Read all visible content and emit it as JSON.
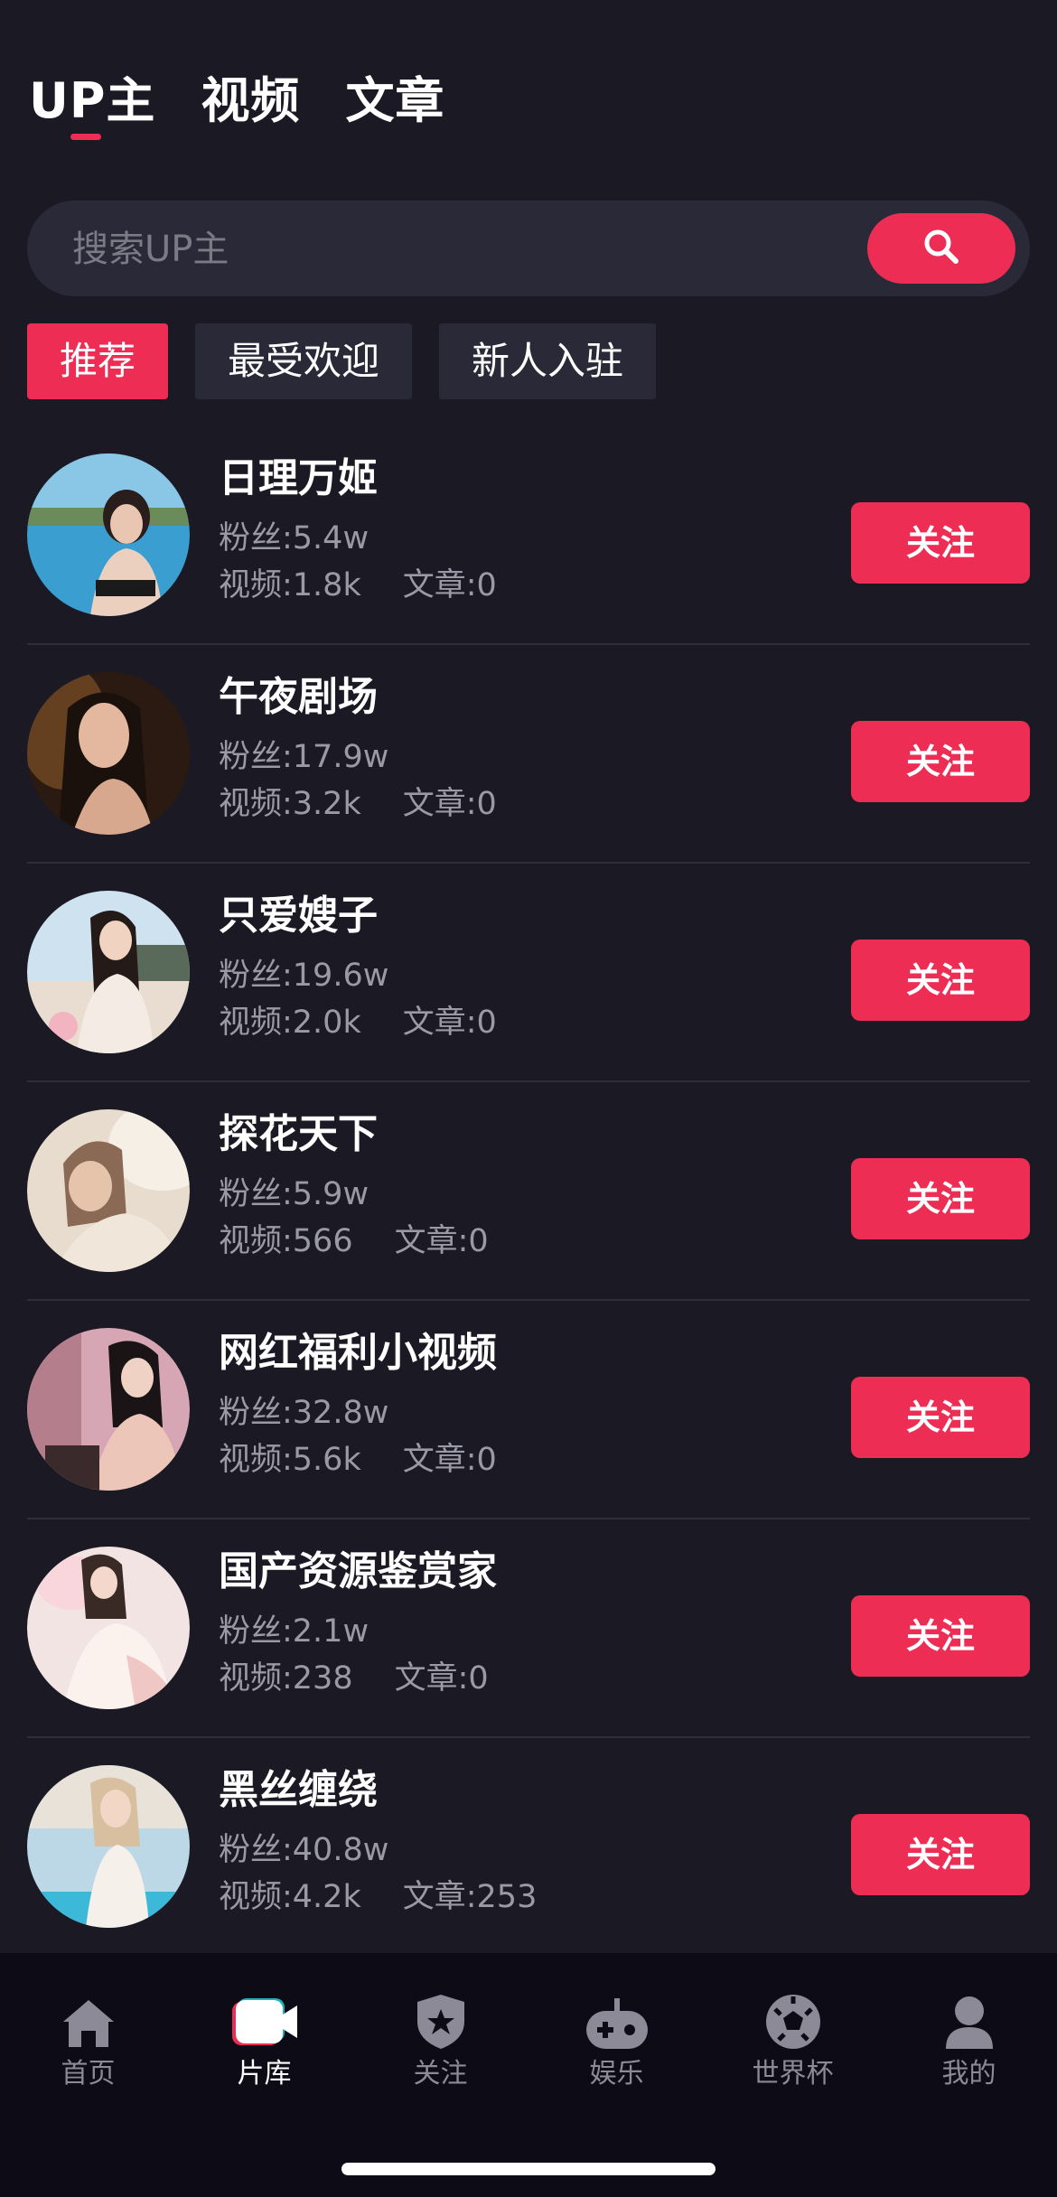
{
  "top_tabs": [
    {
      "label": "UP主",
      "active": true
    },
    {
      "label": "视频",
      "active": false
    },
    {
      "label": "文章",
      "active": false
    }
  ],
  "search": {
    "placeholder": "搜索UP主",
    "icon": "search-icon"
  },
  "filters": [
    {
      "label": "推荐",
      "active": true
    },
    {
      "label": "最受欢迎",
      "active": false
    },
    {
      "label": "新人入驻",
      "active": false
    }
  ],
  "uploaders": [
    {
      "name": "日理万姬",
      "fans": "粉丝:5.4w",
      "videos": "视频:1.8k",
      "articles": "文章:0",
      "follow_label": "关注"
    },
    {
      "name": "午夜剧场",
      "fans": "粉丝:17.9w",
      "videos": "视频:3.2k",
      "articles": "文章:0",
      "follow_label": "关注"
    },
    {
      "name": "只爱嫂子",
      "fans": "粉丝:19.6w",
      "videos": "视频:2.0k",
      "articles": "文章:0",
      "follow_label": "关注"
    },
    {
      "name": "探花天下",
      "fans": "粉丝:5.9w",
      "videos": "视频:566",
      "articles": "文章:0",
      "follow_label": "关注"
    },
    {
      "name": "网红福利小视频",
      "fans": "粉丝:32.8w",
      "videos": "视频:5.6k",
      "articles": "文章:0",
      "follow_label": "关注"
    },
    {
      "name": "国产资源鉴赏家",
      "fans": "粉丝:2.1w",
      "videos": "视频:238",
      "articles": "文章:0",
      "follow_label": "关注"
    },
    {
      "name": "黑丝缠绕",
      "fans": "粉丝:40.8w",
      "videos": "视频:4.2k",
      "articles": "文章:253",
      "follow_label": "关注"
    }
  ],
  "bottom_nav": [
    {
      "label": "首页",
      "icon": "home-icon",
      "active": false
    },
    {
      "label": "片库",
      "icon": "video-camera-icon",
      "active": true
    },
    {
      "label": "关注",
      "icon": "shield-star-icon",
      "active": false
    },
    {
      "label": "娱乐",
      "icon": "gamepad-icon",
      "active": false
    },
    {
      "label": "世界杯",
      "icon": "soccer-ball-icon",
      "active": false
    },
    {
      "label": "我的",
      "icon": "user-icon",
      "active": false
    }
  ],
  "colors": {
    "background": "#1b1a24",
    "accent": "#ee2d55",
    "panel": "#2a2937",
    "muted_text": "#9a99a6",
    "nav_background": "#0d0c16"
  }
}
